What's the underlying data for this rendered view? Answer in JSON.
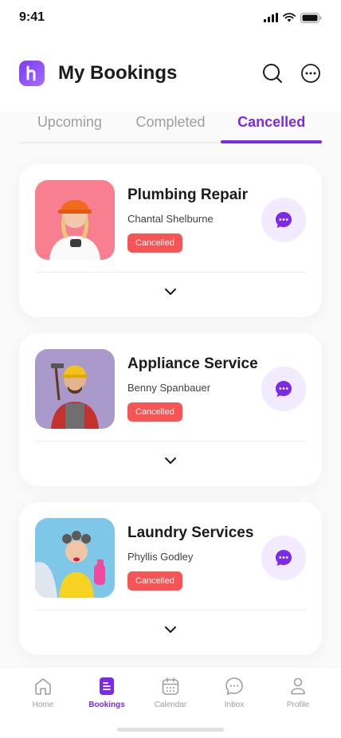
{
  "status_bar": {
    "time": "9:41"
  },
  "header": {
    "title": "My Bookings"
  },
  "tabs": [
    {
      "label": "Upcoming",
      "active": false
    },
    {
      "label": "Completed",
      "active": false
    },
    {
      "label": "Cancelled",
      "active": true
    }
  ],
  "bookings": [
    {
      "service": "Plumbing Repair",
      "provider": "Chantal Shelburne",
      "status": "Cancelled",
      "photo_bg": "#f77f8f"
    },
    {
      "service": "Appliance Service",
      "provider": "Benny Spanbauer",
      "status": "Cancelled",
      "photo_bg": "#a99acb"
    },
    {
      "service": "Laundry Services",
      "provider": "Phyllis Godley",
      "status": "Cancelled",
      "photo_bg": "#7fc7e8"
    }
  ],
  "nav": [
    {
      "label": "Home",
      "icon": "home-icon",
      "active": false
    },
    {
      "label": "Bookings",
      "icon": "document-icon",
      "active": true
    },
    {
      "label": "Calendar",
      "icon": "calendar-icon",
      "active": false
    },
    {
      "label": "Inbox",
      "icon": "chat-icon",
      "active": false
    },
    {
      "label": "Profile",
      "icon": "profile-icon",
      "active": false
    }
  ],
  "colors": {
    "primary": "#7b2be8",
    "cancelled": "#f75555",
    "chat_bg": "#f2ebff"
  }
}
